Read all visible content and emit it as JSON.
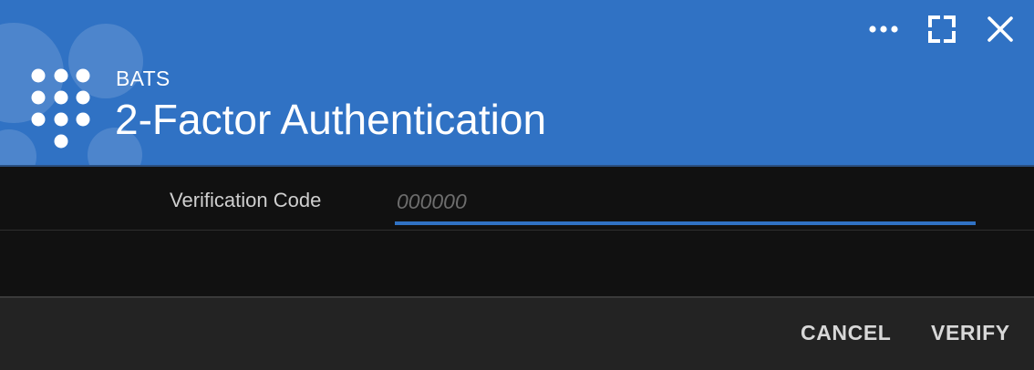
{
  "header": {
    "subtitle": "BATS",
    "title": "2-Factor Authentication",
    "background_color": "#3072c4",
    "logo_icon": "keypad-dots-logo"
  },
  "window_controls": {
    "more_icon": "more-horizontal-icon",
    "fullscreen_icon": "fullscreen-icon",
    "close_icon": "close-icon"
  },
  "form": {
    "verification_label": "Verification Code",
    "verification_placeholder": "000000",
    "verification_value": ""
  },
  "footer": {
    "cancel_label": "CANCEL",
    "verify_label": "VERIFY"
  }
}
